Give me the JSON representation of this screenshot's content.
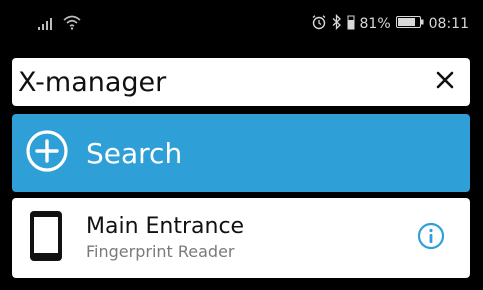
{
  "status_bar": {
    "battery_percent": "81%",
    "time": "08:11",
    "battery_level": 0.81
  },
  "search": {
    "value": "X-manager",
    "button_label": "Search"
  },
  "devices": [
    {
      "name": "Main Entrance",
      "type": "Fingerprint Reader",
      "icon": "phone-device-icon"
    }
  ],
  "colors": {
    "accent": "#2f9fd8",
    "background": "#000000",
    "card": "#ffffff",
    "secondary_text": "#7a7a7a"
  }
}
